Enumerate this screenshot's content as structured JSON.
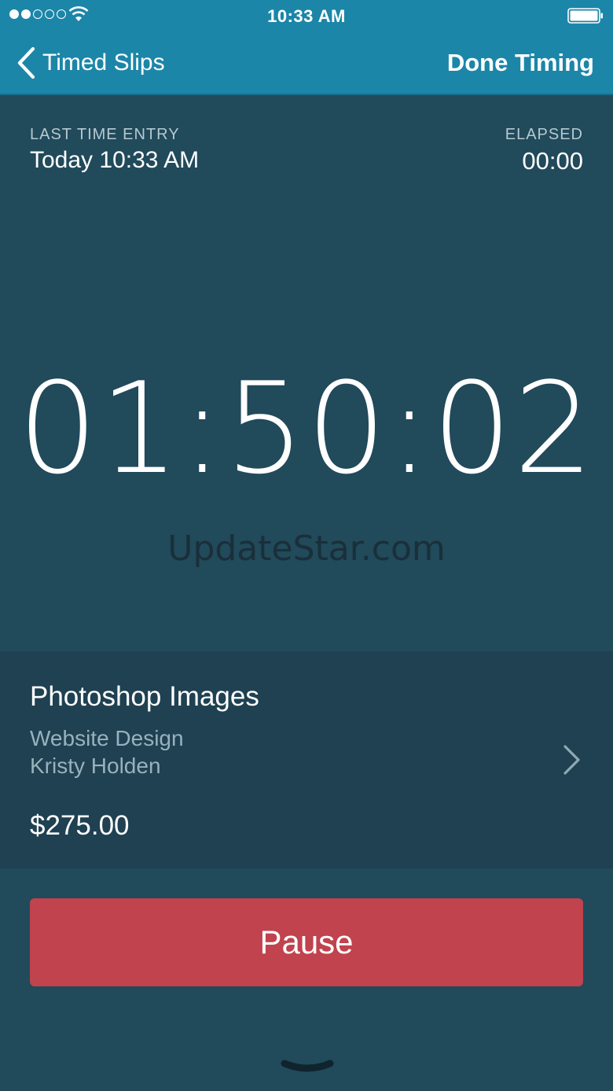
{
  "status_bar": {
    "time": "10:33 AM",
    "signal_bars_filled": 2,
    "signal_bars_total": 5,
    "wifi_icon": "wifi-icon",
    "battery_icon": "battery-icon",
    "battery_level": 1.0
  },
  "nav": {
    "back_label": "Timed Slips",
    "back_icon": "chevron-left-icon",
    "done_label": "Done Timing"
  },
  "summary": {
    "last_entry_label": "LAST TIME ENTRY",
    "last_entry_value": "Today 10:33 AM",
    "elapsed_label": "ELAPSED",
    "elapsed_value": "00:00"
  },
  "timer": {
    "value": "01:50:02"
  },
  "watermark": "UpdateStar.com",
  "project": {
    "name": "Photoshop Images",
    "client": "Website Design",
    "person": "Kristy Holden",
    "amount": "$275.00",
    "chevron_icon": "chevron-right-icon"
  },
  "actions": {
    "pause_label": "Pause",
    "collapse_icon": "chevron-down-icon"
  },
  "colors": {
    "nav_bar": "#1c86a8",
    "background": "#214a5b",
    "card": "#1f4152",
    "pause_button": "#c0434d"
  }
}
